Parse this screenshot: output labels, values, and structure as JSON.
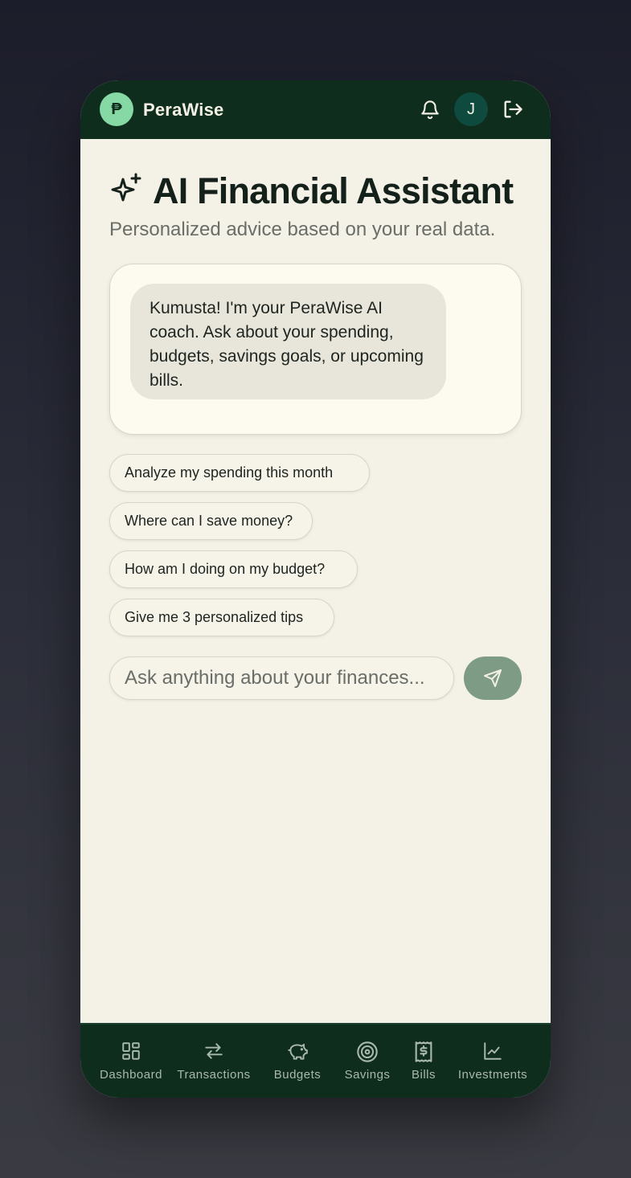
{
  "header": {
    "logo_symbol": "₱",
    "app_name": "PeraWise",
    "avatar_initial": "J",
    "icons": [
      "bell-icon",
      "logout-icon"
    ],
    "colors": {
      "bar": "#0f2d1d",
      "logo": "#86d8a4",
      "avatar": "#0f4a3f"
    }
  },
  "page": {
    "title": "AI Financial Assistant",
    "subtitle": "Personalized advice based on your real data."
  },
  "chat": {
    "messages": [
      {
        "role": "assistant",
        "text": "Kumusta! I'm your PeraWise AI coach. Ask about your spending, budgets, savings goals, or upcoming bills."
      }
    ]
  },
  "suggestions": [
    "Analyze my spending this month",
    "Where can I save money?",
    "How am I doing on my budget?",
    "Give me 3 personalized tips"
  ],
  "composer": {
    "placeholder": "Ask anything about your finances...",
    "send_icon": "send-icon"
  },
  "nav": {
    "items": [
      {
        "label": "Dashboard",
        "icon": "grid-icon"
      },
      {
        "label": "Transactions",
        "icon": "arrows-icon"
      },
      {
        "label": "Budgets",
        "icon": "piggy-bank-icon"
      },
      {
        "label": "Savings",
        "icon": "target-icon"
      },
      {
        "label": "Bills",
        "icon": "receipt-icon"
      },
      {
        "label": "Investments",
        "icon": "chart-icon"
      }
    ]
  },
  "colors": {
    "background": "#f4f1e6",
    "accent": "#0f2d1d",
    "send_button": "#7e9b86"
  }
}
